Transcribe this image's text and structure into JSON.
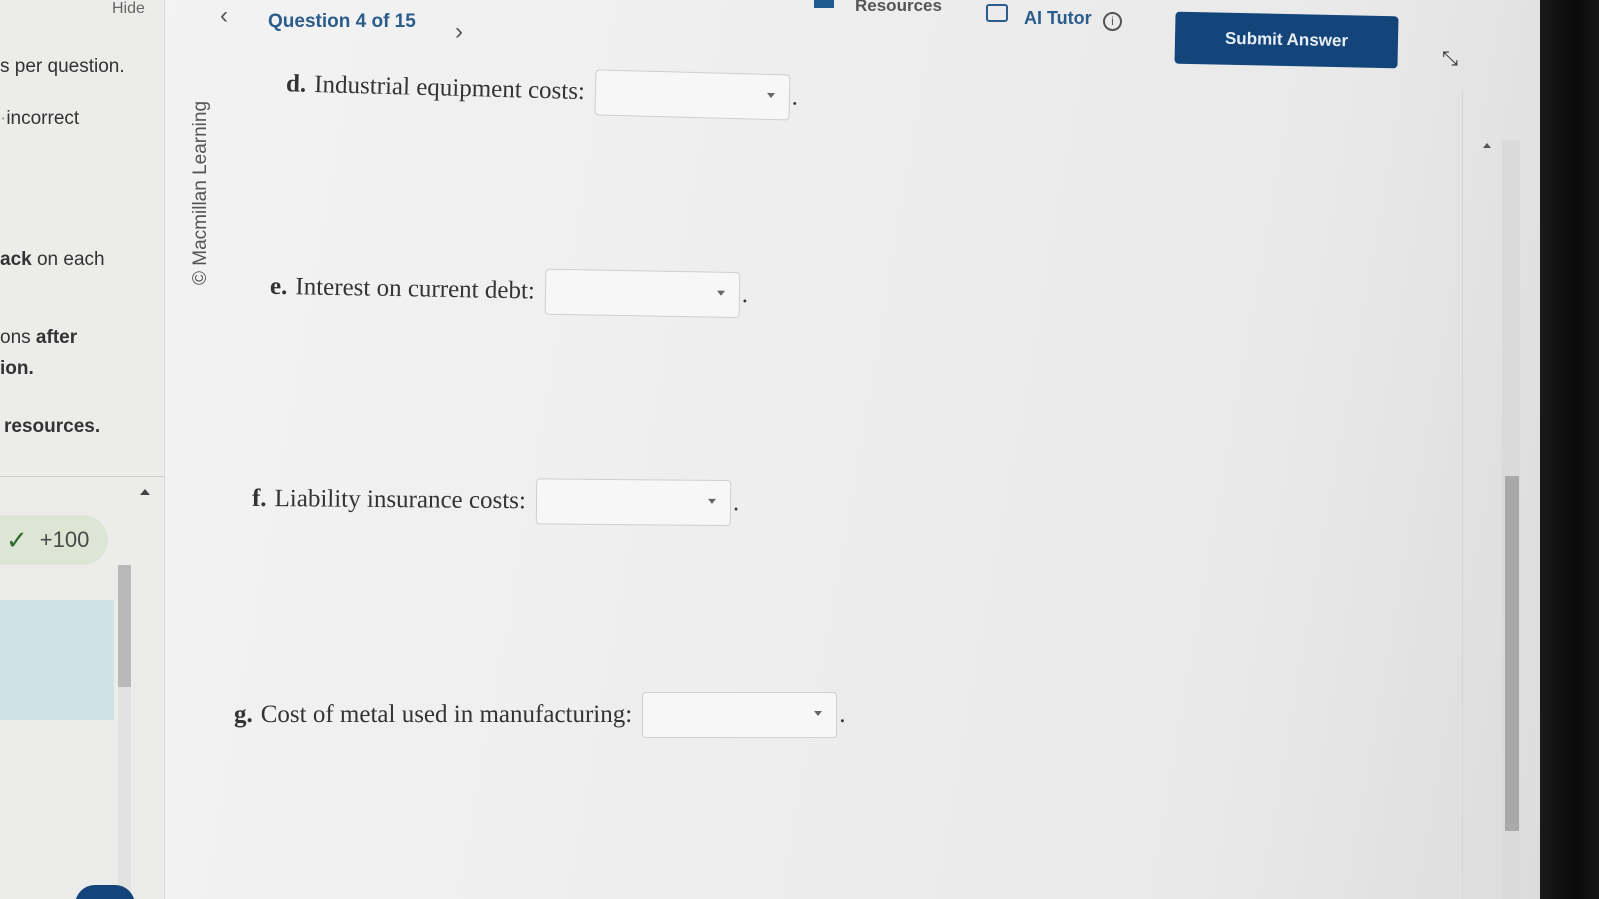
{
  "sidebar": {
    "hide_label": "Hide",
    "lines": [
      {
        "text": "s per question.",
        "bold": false
      },
      {
        "text": "incorrect",
        "bold": false
      },
      {
        "text_bold": "ack",
        "text": " on each"
      },
      {
        "text": "ons ",
        "text_bold": "after"
      },
      {
        "text_bold": "ion."
      },
      {
        "text_bold": "resources."
      }
    ],
    "score": "+100"
  },
  "copyright": "© Macmillan Learning",
  "header": {
    "question_label": "Question 4 of 15",
    "resources_label": "Resources",
    "ai_tutor_label": "AI Tutor",
    "submit_label": "Submit Answer"
  },
  "questions": [
    {
      "letter": "d.",
      "text": "Industrial equipment costs:",
      "value": ""
    },
    {
      "letter": "e.",
      "text": "Interest on current debt:",
      "value": ""
    },
    {
      "letter": "f.",
      "text": "Liability insurance costs:",
      "value": ""
    },
    {
      "letter": "g.",
      "text": "Cost of metal used in manufacturing:",
      "value": ""
    }
  ],
  "icons": {
    "prev": "chevron-left-icon",
    "next": "chevron-right-icon",
    "resources": "book-icon",
    "ai_tutor": "robot-icon",
    "info": "info-icon",
    "collapse": "collapse-arrows-icon",
    "check": "check-icon"
  },
  "colors": {
    "accent": "#14457a",
    "link": "#2a5c8c",
    "score_bg": "#dde6d4"
  }
}
